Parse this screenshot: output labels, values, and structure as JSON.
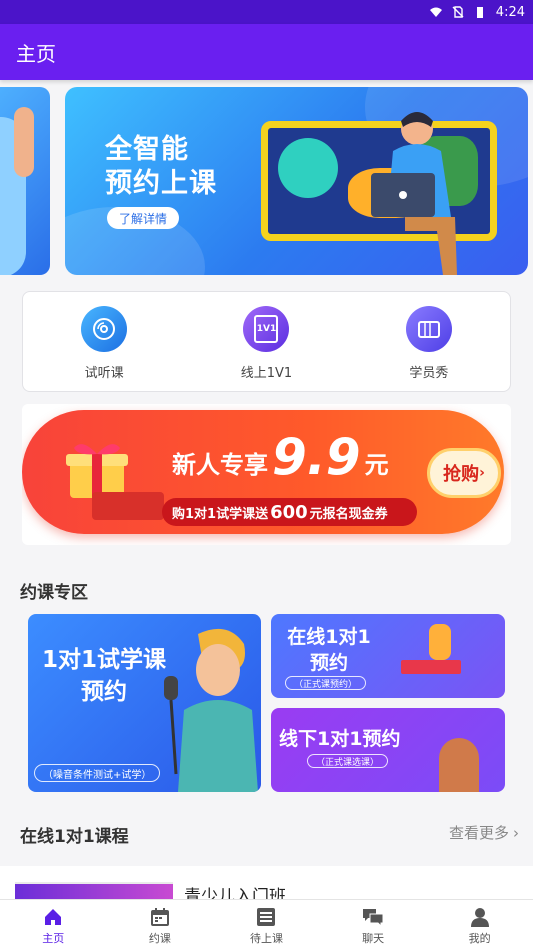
{
  "status_bar": {
    "time": "4:24",
    "icons": [
      "wifi-icon",
      "no-sim-icon",
      "battery-icon"
    ]
  },
  "app_bar": {
    "title": "主页"
  },
  "banner": {
    "title_line1": "全智能",
    "title_line2": "预约上课",
    "button_label": "了解详情",
    "slide_count": 3,
    "active_slide": 1
  },
  "quick_entries": [
    {
      "label": "试听课",
      "icon": "disc-icon",
      "color": "#2c8ff0"
    },
    {
      "label": "线上1V1",
      "icon": "book-1v1-icon",
      "icon_text": "1V1",
      "color": "#7b3df0"
    },
    {
      "label": "学员秀",
      "icon": "album-icon",
      "color": "#6a5af5"
    }
  ],
  "promo": {
    "headline_prefix": "新人专享",
    "price": "9.9",
    "unit": "元",
    "sub_prefix": "购1对1试学课送",
    "sub_amount": "600",
    "sub_suffix": "元报名现金券",
    "button_label": "抢购"
  },
  "booking_zone": {
    "title": "约课专区",
    "cards": [
      {
        "line1": "1对1试学课",
        "line2": "预约",
        "tag": "（噪音条件测试+试学）"
      },
      {
        "line1": "在线1对1",
        "line2": "预约",
        "tag": "（正式课预约）"
      },
      {
        "line1": "线下1对1预约",
        "line2": "",
        "tag": "（正式课选课）"
      }
    ]
  },
  "online_courses": {
    "title": "在线1对1课程",
    "more_label": "查看更多",
    "items": [
      {
        "name": "青少儿入门班"
      }
    ]
  },
  "tabs": [
    {
      "label": "主页",
      "icon": "home-icon",
      "active": true
    },
    {
      "label": "约课",
      "icon": "calendar-icon",
      "active": false
    },
    {
      "label": "待上课",
      "icon": "list-icon",
      "active": false
    },
    {
      "label": "聊天",
      "icon": "chat-icon",
      "active": false
    },
    {
      "label": "我的",
      "icon": "person-icon",
      "active": false
    }
  ],
  "colors": {
    "primary": "#6a1ff0",
    "status_bar": "#4b14c9",
    "tab_active": "#5a1fe6",
    "promo_red": "#f8433a"
  }
}
